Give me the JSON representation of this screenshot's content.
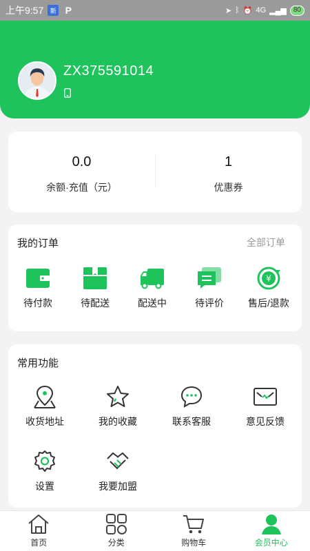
{
  "status_bar": {
    "time": "上午9:57",
    "notif_app1": "新",
    "notif_app2": "P",
    "network": "4G",
    "battery": "80"
  },
  "profile": {
    "username": "ZX375591014"
  },
  "balance": {
    "amount": "0.0",
    "amount_label": "余额·充值（元）",
    "coupons": "1",
    "coupons_label": "优惠券"
  },
  "orders": {
    "title": "我的订单",
    "all_label": "全部订单",
    "items": [
      {
        "label": "待付款",
        "icon": "wallet-icon"
      },
      {
        "label": "待配送",
        "icon": "box-icon"
      },
      {
        "label": "配送中",
        "icon": "truck-icon"
      },
      {
        "label": "待评价",
        "icon": "comment-icon"
      },
      {
        "label": "售后/退款",
        "icon": "refund-icon"
      }
    ]
  },
  "functions": {
    "title": "常用功能",
    "items": [
      {
        "label": "收货地址",
        "icon": "location-icon"
      },
      {
        "label": "我的收藏",
        "icon": "star-icon"
      },
      {
        "label": "联系客服",
        "icon": "chat-icon"
      },
      {
        "label": "意见反馈",
        "icon": "mail-icon"
      },
      {
        "label": "设置",
        "icon": "settings-icon"
      },
      {
        "label": "我要加盟",
        "icon": "handshake-icon"
      }
    ]
  },
  "tabbar": {
    "items": [
      {
        "label": "首页",
        "icon": "home-icon"
      },
      {
        "label": "分类",
        "icon": "category-icon"
      },
      {
        "label": "购物车",
        "icon": "cart-icon"
      },
      {
        "label": "会员中心",
        "icon": "member-icon"
      }
    ],
    "active": "会员中心"
  },
  "colors": {
    "primary": "#1ec35c",
    "background": "#f3f3f3"
  }
}
